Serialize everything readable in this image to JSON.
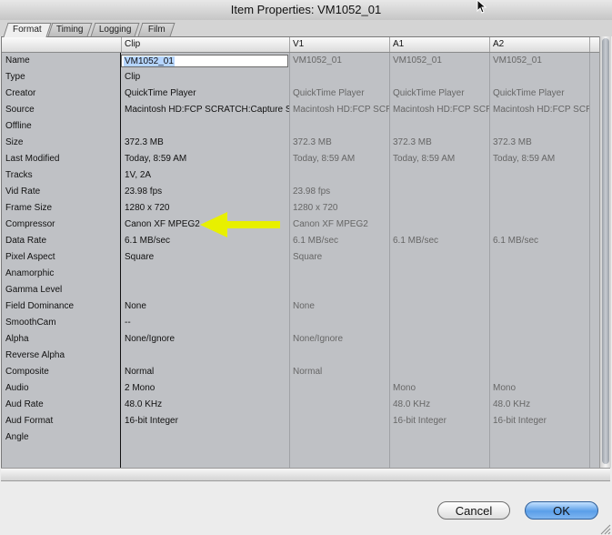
{
  "window": {
    "title": "Item Properties: VM1052_01"
  },
  "tabs": [
    {
      "label": "Format",
      "active": true
    },
    {
      "label": "Timing",
      "active": false
    },
    {
      "label": "Logging",
      "active": false
    },
    {
      "label": "Film",
      "active": false
    }
  ],
  "columns": {
    "name": "",
    "clip": "Clip",
    "v1": "V1",
    "a1": "A1",
    "a2": "A2"
  },
  "rows": [
    {
      "name": "Name",
      "clip": "VM1052_01",
      "v1": "VM1052_01",
      "a1": "VM1052_01",
      "a2": "VM1052_01",
      "editing": true
    },
    {
      "name": "Type",
      "clip": "Clip",
      "v1": "",
      "a1": "",
      "a2": ""
    },
    {
      "name": "Creator",
      "clip": "QuickTime Player",
      "v1": "QuickTime Player",
      "a1": "QuickTime Player",
      "a2": "QuickTime Player"
    },
    {
      "name": "Source",
      "clip": "Macintosh HD:FCP SCRATCH:Capture Scra",
      "v1": "Macintosh HD:FCP SCRA",
      "a1": "Macintosh HD:FCP SCRA",
      "a2": "Macintosh HD:FCP SCRA"
    },
    {
      "name": "Offline",
      "clip": "",
      "v1": "",
      "a1": "",
      "a2": ""
    },
    {
      "name": "Size",
      "clip": "372.3 MB",
      "v1": "372.3 MB",
      "a1": "372.3 MB",
      "a2": "372.3 MB"
    },
    {
      "name": "Last Modified",
      "clip": "Today, 8:59 AM",
      "v1": "Today, 8:59 AM",
      "a1": "Today, 8:59 AM",
      "a2": "Today, 8:59 AM"
    },
    {
      "name": "Tracks",
      "clip": "1V, 2A",
      "v1": "",
      "a1": "",
      "a2": ""
    },
    {
      "name": "Vid Rate",
      "clip": "23.98 fps",
      "v1": "23.98 fps",
      "a1": "",
      "a2": ""
    },
    {
      "name": "Frame Size",
      "clip": "1280 x 720",
      "v1": "1280 x 720",
      "a1": "",
      "a2": ""
    },
    {
      "name": "Compressor",
      "clip": "Canon XF MPEG2",
      "v1": "Canon XF MPEG2",
      "a1": "",
      "a2": ""
    },
    {
      "name": "Data Rate",
      "clip": "6.1 MB/sec",
      "v1": "6.1 MB/sec",
      "a1": "6.1 MB/sec",
      "a2": "6.1 MB/sec"
    },
    {
      "name": "Pixel Aspect",
      "clip": "Square",
      "v1": "Square",
      "a1": "",
      "a2": ""
    },
    {
      "name": "Anamorphic",
      "clip": "",
      "v1": "",
      "a1": "",
      "a2": ""
    },
    {
      "name": "Gamma Level",
      "clip": "",
      "v1": "",
      "a1": "",
      "a2": ""
    },
    {
      "name": "Field Dominance",
      "clip": "None",
      "v1": "None",
      "a1": "",
      "a2": ""
    },
    {
      "name": "SmoothCam",
      "clip": "--",
      "v1": "",
      "a1": "",
      "a2": ""
    },
    {
      "name": "Alpha",
      "clip": "None/Ignore",
      "v1": "None/Ignore",
      "a1": "",
      "a2": ""
    },
    {
      "name": "Reverse Alpha",
      "clip": "",
      "v1": "",
      "a1": "",
      "a2": ""
    },
    {
      "name": "Composite",
      "clip": "Normal",
      "v1": "Normal",
      "a1": "",
      "a2": ""
    },
    {
      "name": "Audio",
      "clip": "2 Mono",
      "v1": "",
      "a1": "Mono",
      "a2": "Mono"
    },
    {
      "name": "Aud Rate",
      "clip": "48.0 KHz",
      "v1": "",
      "a1": "48.0 KHz",
      "a2": "48.0 KHz"
    },
    {
      "name": "Aud Format",
      "clip": "16-bit Integer",
      "v1": "",
      "a1": "16-bit Integer",
      "a2": "16-bit Integer"
    },
    {
      "name": "Angle",
      "clip": "",
      "v1": "",
      "a1": "",
      "a2": ""
    }
  ],
  "buttons": {
    "cancel": "Cancel",
    "ok": "OK"
  },
  "annotation": {
    "icon": "yellow-arrow-icon",
    "color": "#e8f000"
  },
  "colors": {
    "grid_bg": "#bfc1c5",
    "ok_button": "#5a9ee8"
  }
}
